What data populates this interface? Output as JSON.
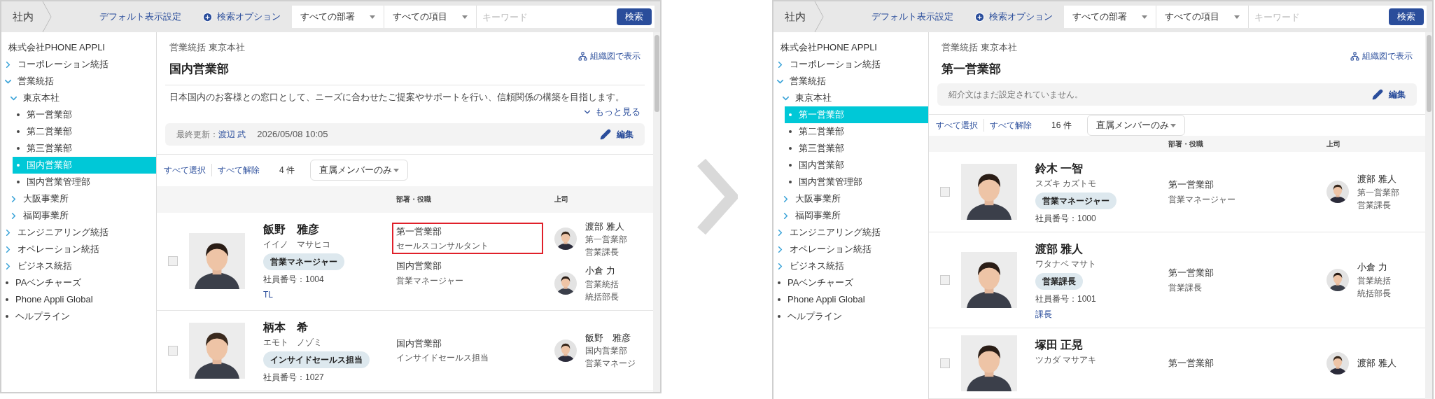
{
  "panels": [
    {
      "top_bar": {
        "scope": "社内",
        "default_view_link": "デフォルト表示設定",
        "search_options": "検索オプション",
        "department_select": "すべての部署",
        "field_select": "すべての項目",
        "keyword": {
          "placeholder": "キーワード"
        },
        "search_button": "検索"
      },
      "sidebar": {
        "company": "株式会社PHONE APPLI",
        "items": [
          {
            "kind": "group",
            "label": "コーポレーション統括",
            "expanded": false,
            "selected": false
          },
          {
            "kind": "group",
            "label": "営業統括",
            "expanded": true,
            "selected": false,
            "children": [
              {
                "kind": "group",
                "label": "東京本社",
                "expanded": true,
                "selected": false,
                "children": [
                  {
                    "kind": "leaf",
                    "label": "第一営業部",
                    "selected": false
                  },
                  {
                    "kind": "leaf",
                    "label": "第二営業部",
                    "selected": false
                  },
                  {
                    "kind": "leaf",
                    "label": "第三営業部",
                    "selected": false
                  },
                  {
                    "kind": "leaf",
                    "label": "国内営業部",
                    "selected": true
                  },
                  {
                    "kind": "leaf",
                    "label": "国内営業管理部",
                    "selected": false
                  }
                ]
              },
              {
                "kind": "group",
                "label": "大阪事業所",
                "expanded": false,
                "selected": false
              },
              {
                "kind": "group",
                "label": "福岡事業所",
                "expanded": false,
                "selected": false
              }
            ]
          },
          {
            "kind": "group",
            "label": "エンジニアリング統括",
            "expanded": false,
            "selected": false
          },
          {
            "kind": "group",
            "label": "オペレーション統括",
            "expanded": false,
            "selected": false
          },
          {
            "kind": "group",
            "label": "ビジネス統括",
            "expanded": false,
            "selected": false
          },
          {
            "kind": "leaf",
            "label": "PAベンチャーズ",
            "selected": false
          },
          {
            "kind": "leaf",
            "label": "Phone Appli Global",
            "selected": false
          },
          {
            "kind": "leaf",
            "label": "ヘルプライン",
            "selected": false
          }
        ]
      },
      "main": {
        "breadcrumb": "営業統括 東京本社",
        "org_chart_link": "組織図で表示",
        "title": "国内営業部",
        "description": {
          "text": "日本国内のお客様との窓口として、ニーズに合わせたご提案やサポートを行い、信頼関係の構築を目指します。",
          "more_link": "もっと見る"
        },
        "info_box": {
          "kind": "updated",
          "label": "最終更新：",
          "user": "渡辺 武",
          "timestamp": "2026/05/08 10:05",
          "edit_button": "編集"
        },
        "toolbar": {
          "select_all": "すべて選択",
          "deselect_all": "すべて解除",
          "count": "4 件",
          "filter": "直属メンバーのみ"
        },
        "columns": [
          "部署・役職",
          "上司"
        ],
        "rows": [
          {
            "checked": false,
            "name": "飯野　雅彦",
            "kana": "イイノ　マサヒコ",
            "badge": "営業マネージャー",
            "employee_no": "社員番号：1004",
            "note": "TL",
            "positions": [
              {
                "department": "第一営業部",
                "title": "セールスコンサルタント",
                "highlighted": true
              },
              {
                "department": "国内営業部",
                "title": "営業マネージャー",
                "highlighted": false
              }
            ],
            "managers": [
              {
                "name": "渡部 雅人",
                "department": "第一営業部",
                "title": "営業課長"
              },
              {
                "name": "小倉 力",
                "department": "営業統括",
                "title": "統括部長"
              }
            ]
          },
          {
            "checked": false,
            "name": "柄本　希",
            "kana": "エモト　ノゾミ",
            "badge": "インサイドセールス担当",
            "employee_no": "社員番号：1027",
            "positions": [
              {
                "department": "国内営業部",
                "title": "インサイドセールス担当",
                "highlighted": false
              }
            ],
            "managers": [
              {
                "name": "飯野　雅彦",
                "department": "国内営業部",
                "title": "営業マネージ"
              }
            ]
          }
        ]
      }
    },
    {
      "top_bar": {
        "scope": "社内",
        "default_view_link": "デフォルト表示設定",
        "search_options": "検索オプション",
        "department_select": "すべての部署",
        "field_select": "すべての項目",
        "keyword": {
          "placeholder": "キーワード"
        },
        "search_button": "検索"
      },
      "sidebar": {
        "company": "株式会社PHONE APPLI",
        "items": [
          {
            "kind": "group",
            "label": "コーポレーション統括",
            "expanded": false,
            "selected": false
          },
          {
            "kind": "group",
            "label": "営業統括",
            "expanded": true,
            "selected": false,
            "children": [
              {
                "kind": "group",
                "label": "東京本社",
                "expanded": true,
                "selected": false,
                "children": [
                  {
                    "kind": "leaf",
                    "label": "第一営業部",
                    "selected": true
                  },
                  {
                    "kind": "leaf",
                    "label": "第二営業部",
                    "selected": false
                  },
                  {
                    "kind": "leaf",
                    "label": "第三営業部",
                    "selected": false
                  },
                  {
                    "kind": "leaf",
                    "label": "国内営業部",
                    "selected": false
                  },
                  {
                    "kind": "leaf",
                    "label": "国内営業管理部",
                    "selected": false
                  }
                ]
              },
              {
                "kind": "group",
                "label": "大阪事業所",
                "expanded": false,
                "selected": false
              },
              {
                "kind": "group",
                "label": "福岡事業所",
                "expanded": false,
                "selected": false
              }
            ]
          },
          {
            "kind": "group",
            "label": "エンジニアリング統括",
            "expanded": false,
            "selected": false
          },
          {
            "kind": "group",
            "label": "オペレーション統括",
            "expanded": false,
            "selected": false
          },
          {
            "kind": "group",
            "label": "ビジネス統括",
            "expanded": false,
            "selected": false
          },
          {
            "kind": "leaf",
            "label": "PAベンチャーズ",
            "selected": false
          },
          {
            "kind": "leaf",
            "label": "Phone Appli Global",
            "selected": false
          },
          {
            "kind": "leaf",
            "label": "ヘルプライン",
            "selected": false
          }
        ]
      },
      "main": {
        "breadcrumb": "営業統括 東京本社",
        "org_chart_link": "組織図で表示",
        "title": "第一営業部",
        "info_box": {
          "kind": "intro",
          "text": "紹介文はまだ設定されていません。",
          "edit_button": "編集"
        },
        "toolbar": {
          "select_all": "すべて選択",
          "deselect_all": "すべて解除",
          "count": "16 件",
          "filter": "直属メンバーのみ"
        },
        "columns": [
          "部署・役職",
          "上司"
        ],
        "rows": [
          {
            "checked": false,
            "name": "鈴木 一智",
            "kana": "スズキ カズトモ",
            "badge": "営業マネージャー",
            "employee_no": "社員番号：1000",
            "positions": [
              {
                "department": "第一営業部",
                "title": "営業マネージャー",
                "highlighted": false
              }
            ],
            "managers": [
              {
                "name": "渡部 雅人",
                "department": "第一営業部",
                "title": "営業課長"
              }
            ]
          },
          {
            "checked": false,
            "name": "渡部 雅人",
            "kana": "ワタナベ マサト",
            "badge": "営業課長",
            "employee_no": "社員番号：1001",
            "note": "課長",
            "positions": [
              {
                "department": "第一営業部",
                "title": "営業課長",
                "highlighted": false
              }
            ],
            "managers": [
              {
                "name": "小倉 力",
                "department": "営業統括",
                "title": "統括部長"
              }
            ]
          },
          {
            "checked": false,
            "name": "塚田 正晃",
            "kana": "ツカダ マサアキ",
            "positions": [
              {
                "department": "第一営業部",
                "highlighted": false
              }
            ],
            "managers": [
              {
                "name": "渡部 雅人"
              }
            ]
          }
        ]
      }
    }
  ]
}
